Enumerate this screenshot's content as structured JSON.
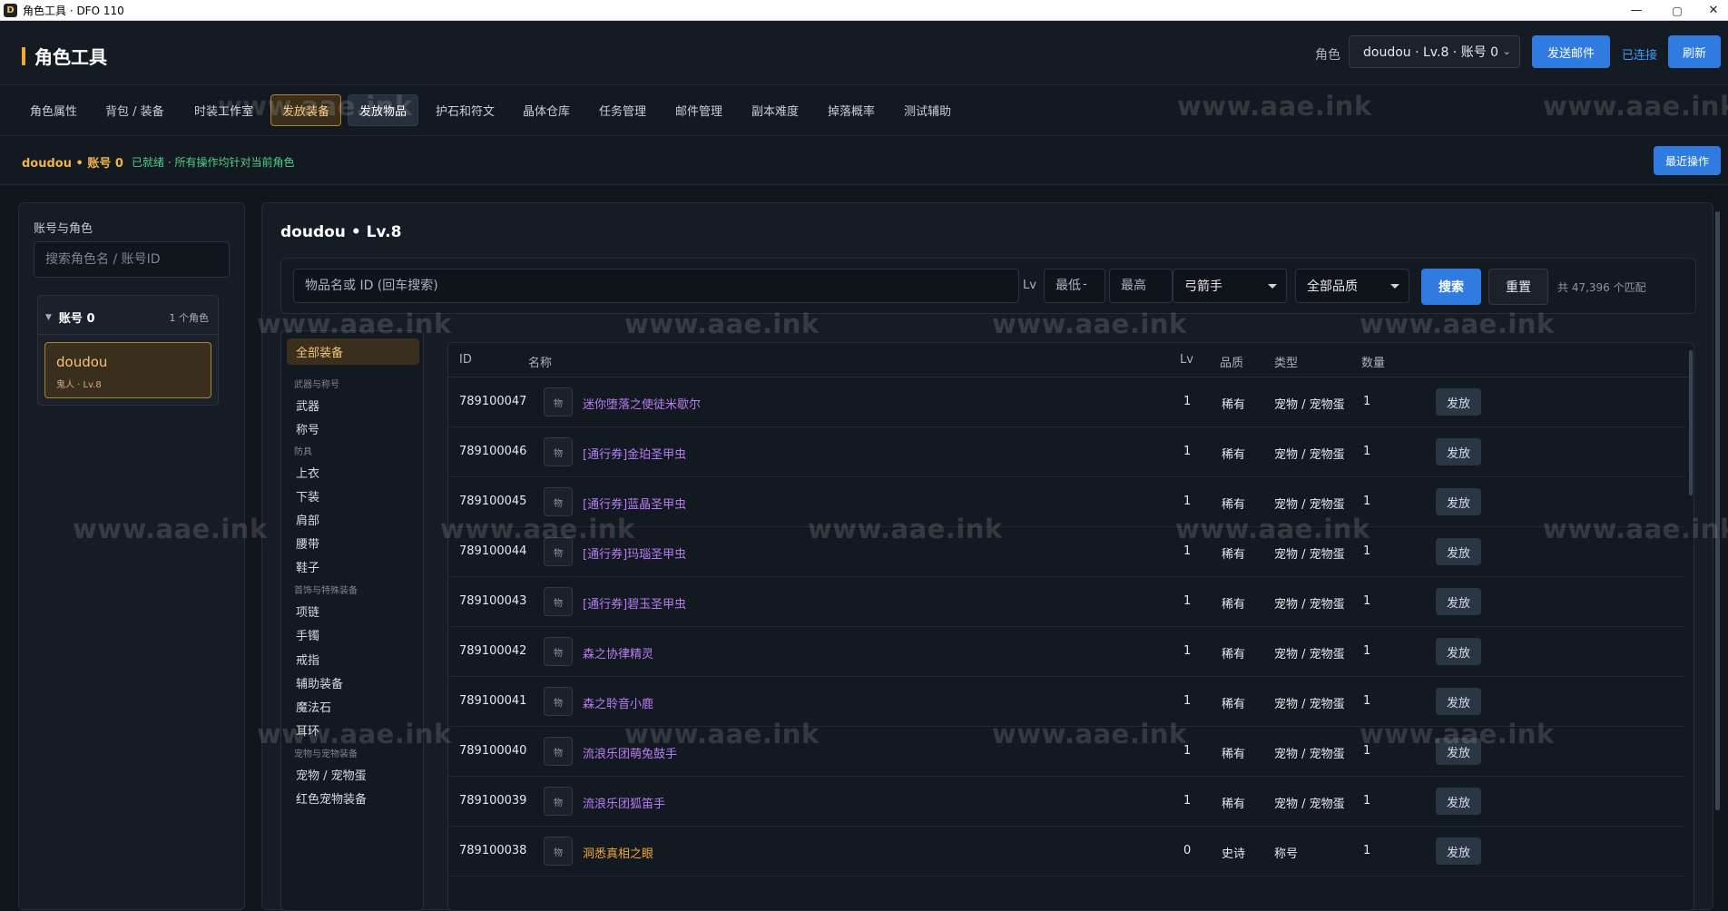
{
  "window": {
    "title": "角色工具 · DFO 110",
    "controls": {
      "minimize": "—",
      "maximize": "▢",
      "close": "✕"
    }
  },
  "header": {
    "brand": "角色工具",
    "role_label": "角色",
    "role_select": "doudou · Lv.8 · 账号 0",
    "send_mail": "发送邮件",
    "connected": "已连接",
    "refresh": "刷新"
  },
  "tabs": [
    "角色属性",
    "背包 / 装备",
    "时装工作室",
    "发放装备",
    "发放物品",
    "护石和符文",
    "晶体仓库",
    "任务管理",
    "邮件管理",
    "副本难度",
    "掉落概率",
    "测试辅助"
  ],
  "status": {
    "character": "doudou • 账号 0",
    "ready_text": "已就绪 · 所有操作均针对当前角色",
    "recent_ops": "最近操作"
  },
  "left_panel": {
    "title": "账号与角色",
    "search_placeholder": "搜索角色名 / 账号ID",
    "account_name": "账号 0",
    "account_count": "1 个角色",
    "character_name": "doudou",
    "character_sub": "鬼人 · Lv.8"
  },
  "main": {
    "title": "doudou • Lv.8",
    "search_placeholder": "物品名或 ID (回车搜索)",
    "lv_label": "Lv",
    "min_placeholder": "最低",
    "dash": "-",
    "max_placeholder": "最高",
    "class_select": "弓箭手",
    "quality_select": "全部品质",
    "search_button": "搜索",
    "reset_button": "重置",
    "match_count": "共 47,396 个匹配"
  },
  "categories": {
    "all": "全部装备",
    "groups": [
      {
        "label": "武器与称号",
        "items": [
          "武器",
          "称号"
        ]
      },
      {
        "label": "防具",
        "items": [
          "上衣",
          "下装",
          "肩部",
          "腰带",
          "鞋子"
        ]
      },
      {
        "label": "首饰与特殊装备",
        "items": [
          "项链",
          "手镯",
          "戒指",
          "辅助装备",
          "魔法石",
          "耳环"
        ]
      },
      {
        "label": "宠物与宠物装备",
        "items": [
          "宠物 / 宠物蛋",
          "红色宠物装备"
        ]
      }
    ]
  },
  "table": {
    "columns": [
      "ID",
      "名称",
      "Lv",
      "品质",
      "类型",
      "数量"
    ],
    "thumb_text": "物",
    "send_label": "发放",
    "rows": [
      {
        "id": "789100047",
        "name": "迷你堕落之使徒米歇尔",
        "lv": "1",
        "quality": "稀有",
        "type": "宠物 / 宠物蛋",
        "qty": "1",
        "tier": "rare"
      },
      {
        "id": "789100046",
        "name": "[通行券]金珀圣甲虫",
        "lv": "1",
        "quality": "稀有",
        "type": "宠物 / 宠物蛋",
        "qty": "1",
        "tier": "rare"
      },
      {
        "id": "789100045",
        "name": "[通行券]蓝晶圣甲虫",
        "lv": "1",
        "quality": "稀有",
        "type": "宠物 / 宠物蛋",
        "qty": "1",
        "tier": "rare"
      },
      {
        "id": "789100044",
        "name": "[通行券]玛瑙圣甲虫",
        "lv": "1",
        "quality": "稀有",
        "type": "宠物 / 宠物蛋",
        "qty": "1",
        "tier": "rare"
      },
      {
        "id": "789100043",
        "name": "[通行券]碧玉圣甲虫",
        "lv": "1",
        "quality": "稀有",
        "type": "宠物 / 宠物蛋",
        "qty": "1",
        "tier": "rare"
      },
      {
        "id": "789100042",
        "name": "森之协律精灵",
        "lv": "1",
        "quality": "稀有",
        "type": "宠物 / 宠物蛋",
        "qty": "1",
        "tier": "rare"
      },
      {
        "id": "789100041",
        "name": "森之聆音小鹿",
        "lv": "1",
        "quality": "稀有",
        "type": "宠物 / 宠物蛋",
        "qty": "1",
        "tier": "rare"
      },
      {
        "id": "789100040",
        "name": "流浪乐团萌兔鼓手",
        "lv": "1",
        "quality": "稀有",
        "type": "宠物 / 宠物蛋",
        "qty": "1",
        "tier": "rare"
      },
      {
        "id": "789100039",
        "name": "流浪乐团狐笛手",
        "lv": "1",
        "quality": "稀有",
        "type": "宠物 / 宠物蛋",
        "qty": "1",
        "tier": "rare"
      },
      {
        "id": "789100038",
        "name": "洞悉真相之眼",
        "lv": "0",
        "quality": "史诗",
        "type": "称号",
        "qty": "1",
        "tier": "epic"
      }
    ]
  },
  "watermark": "www.aae.ink",
  "colors": {
    "accent_gold": "#f0a83a",
    "primary_blue": "#2f7be0",
    "rare_purple": "#b87cf5",
    "epic_orange": "#f1a73b",
    "ready_green": "#4ed08a"
  }
}
